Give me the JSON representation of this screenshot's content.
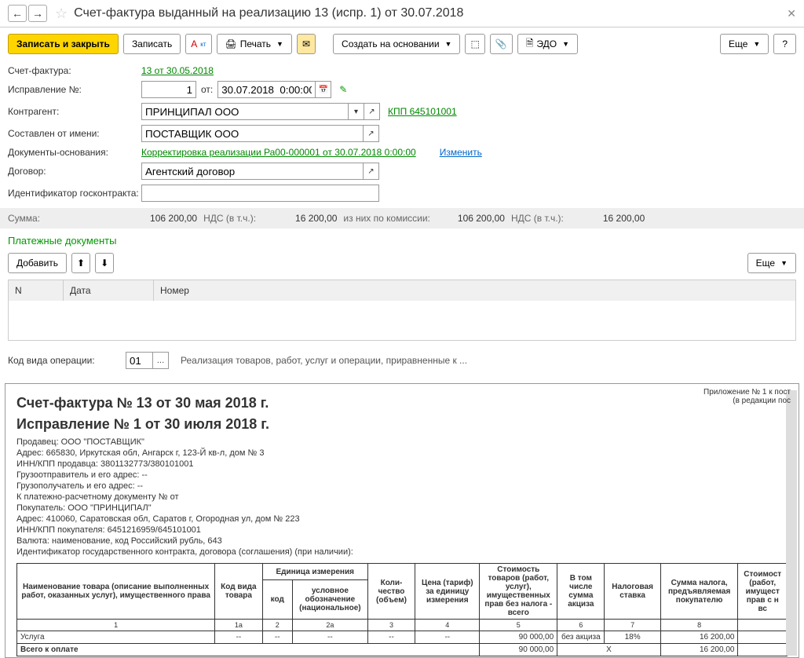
{
  "header": {
    "title": "Счет-фактура выданный на реализацию 13 (испр. 1) от 30.07.2018"
  },
  "toolbar": {
    "save_close": "Записать и закрыть",
    "save": "Записать",
    "print": "Печать",
    "create_based": "Создать на основании",
    "edo": "ЭДО",
    "more": "Еще"
  },
  "form": {
    "invoice_label": "Счет-фактура:",
    "invoice_link": "13 от 30.05.2018",
    "correction_label": "Исправление №:",
    "correction_num": "1",
    "date_label": "от:",
    "date_value": "30.07.2018  0:00:00",
    "contractor_label": "Контрагент:",
    "contractor_value": "ПРИНЦИПАЛ ООО",
    "kpp_link": "КПП 645101001",
    "issued_label": "Составлен от имени:",
    "issued_value": "ПОСТАВЩИК ООО",
    "basis_label": "Документы-основания:",
    "basis_link": "Корректировка реализации Ра00-000001 от 30.07.2018 0:00:00",
    "change_link": "Изменить",
    "contract_label": "Договор:",
    "contract_value": "Агентский договор",
    "goscontract_label": "Идентификатор госконтракта:",
    "goscontract_value": ""
  },
  "sums": {
    "sum_label": "Сумма:",
    "sum_value": "106 200,00",
    "vat_label": "НДС (в т.ч.):",
    "vat_value": "16 200,00",
    "commission_label": "из них по комиссии:",
    "commission_value": "106 200,00",
    "vat2_label": "НДС (в т.ч.):",
    "vat2_value": "16 200,00"
  },
  "payments": {
    "header": "Платежные документы",
    "add": "Добавить",
    "col_n": "N",
    "col_date": "Дата",
    "col_number": "Номер",
    "more": "Еще"
  },
  "operation": {
    "label": "Код вида операции:",
    "code": "01",
    "desc": "Реализация товаров, работ, услуг и операции, приравненные к ..."
  },
  "doc": {
    "annotation1": "Приложение № 1 к пост",
    "annotation2": "(в редакции пос",
    "title1": "Счет-фактура № 13 от 30 мая 2018 г.",
    "title2": "Исправление № 1 от 30 июля 2018 г.",
    "seller": "Продавец: ООО \"ПОСТАВЩИК\"",
    "seller_addr": "Адрес: 665830, Иркутская обл, Ангарск г, 123-Й кв-л, дом № 3",
    "seller_inn": "ИНН/КПП продавца: 3801132773/380101001",
    "shipper": "Грузоотправитель и его адрес: --",
    "consignee": "Грузополучатель и его адрес: --",
    "payment": "К платежно-расчетному документу №     от",
    "buyer": "Покупатель: ООО \"ПРИНЦИПАЛ\"",
    "buyer_addr": "Адрес: 410060, Саратовская обл, Саратов г, Огородная ул, дом № 223",
    "buyer_inn": "ИНН/КПП покупателя: 6451216959/645101001",
    "currency": "Валюта: наименование, код Российский рубль, 643",
    "goscontract": "Идентификатор государственного контракта, договора (соглашения) (при наличии):",
    "th_name": "Наименование товара (описание выполненных работ, оказанных услуг), имущественного права",
    "th_code": "Код вида товара",
    "th_unit": "Единица измерения",
    "th_unit_code": "код",
    "th_unit_symbol": "условное обозначение (национальное)",
    "th_qty": "Коли-чество (объем)",
    "th_price": "Цена (тариф) за единицу измерения",
    "th_cost": "Стоимость товаров (работ, услуг), имущественных прав без налога - всего",
    "th_excise": "В том числе сумма акциза",
    "th_rate": "Налоговая ставка",
    "th_tax": "Сумма налога, предъявляемая покупателю",
    "th_total": "Стоимост (работ, имущест прав с н вс",
    "row_service": "Услуга",
    "row_dash": "--",
    "row_cost": "90 000,00",
    "row_excise": "без акциза",
    "row_rate": "18%",
    "row_tax": "16 200,00",
    "total_label": "Всего к оплате",
    "total_cost": "90 000,00",
    "total_x": "X",
    "total_tax": "16 200,00"
  }
}
